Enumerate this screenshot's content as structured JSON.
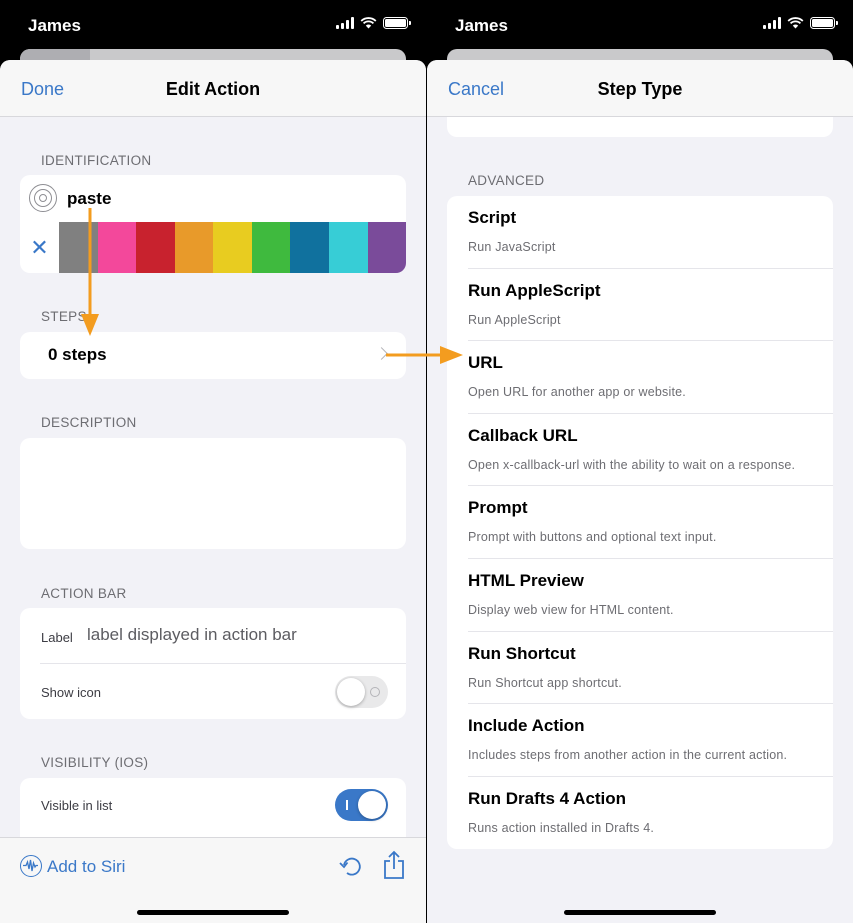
{
  "left": {
    "carrier": "James",
    "nav": {
      "done": "Done",
      "title": "Edit Action"
    },
    "identification": {
      "header": "IDENTIFICATION",
      "name": "paste",
      "swatches": [
        "#808080",
        "#f3489b",
        "#c8222e",
        "#e89a2a",
        "#e8cc20",
        "#3fba3e",
        "#10719e",
        "#37cdd6",
        "#7a4b9a"
      ]
    },
    "steps": {
      "header": "STEPS",
      "label": "0 steps"
    },
    "description": {
      "header": "DESCRIPTION"
    },
    "action_bar": {
      "header": "ACTION BAR",
      "label": "Label",
      "placeholder": "label displayed in action bar",
      "show_icon": "Show icon",
      "show_icon_on": false
    },
    "visibility": {
      "header": "VISIBILITY (IOS)",
      "visible_in_list": "Visible in list",
      "visible_on": true
    },
    "toolbar": {
      "siri": "Add to Siri"
    }
  },
  "right": {
    "carrier": "James",
    "nav": {
      "cancel": "Cancel",
      "title": "Step Type"
    },
    "advanced_header": "ADVANCED",
    "types": [
      {
        "title": "Script",
        "subtitle": "Run JavaScript"
      },
      {
        "title": "Run AppleScript",
        "subtitle": "Run AppleScript"
      },
      {
        "title": "URL",
        "subtitle": "Open URL for another app or website."
      },
      {
        "title": "Callback URL",
        "subtitle": "Open x-callback-url with the ability to wait on a response."
      },
      {
        "title": "Prompt",
        "subtitle": "Prompt with buttons and optional text input."
      },
      {
        "title": "HTML Preview",
        "subtitle": "Display web view for HTML content."
      },
      {
        "title": "Run Shortcut",
        "subtitle": "Run Shortcut app shortcut."
      },
      {
        "title": "Include Action",
        "subtitle": "Includes steps from another action in the current action."
      },
      {
        "title": "Run Drafts 4 Action",
        "subtitle": "Runs action installed in Drafts 4."
      }
    ]
  },
  "colors": {
    "accent": "#3a78c8",
    "annotation_arrow": "#f39c1f"
  }
}
